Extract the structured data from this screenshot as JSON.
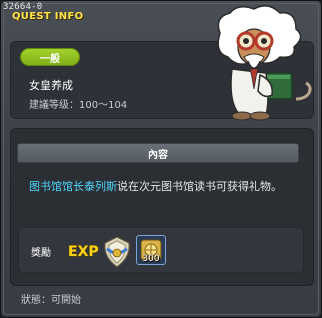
{
  "window": {
    "quest_id": "32664-0",
    "title": "QUEST INFO"
  },
  "quest": {
    "tier": "一般",
    "name": "女皇养成",
    "level_label": "建議等级：",
    "level_range": "100～104"
  },
  "content": {
    "header": "內容",
    "npc_name": "图书馆馆长泰列斯",
    "description_rest": "说在次元图书馆读书可获得礼物。"
  },
  "reward": {
    "label": "獎勵",
    "exp_text": "EXP",
    "item_quantity": "300"
  },
  "status": {
    "label": "狀態：",
    "value": "可開始"
  },
  "colors": {
    "title_yellow": "#ffe34a",
    "tier_green": "#8fc21f",
    "npc_blue": "#4fd8ff",
    "exp_yellow": "#ffd21a"
  }
}
